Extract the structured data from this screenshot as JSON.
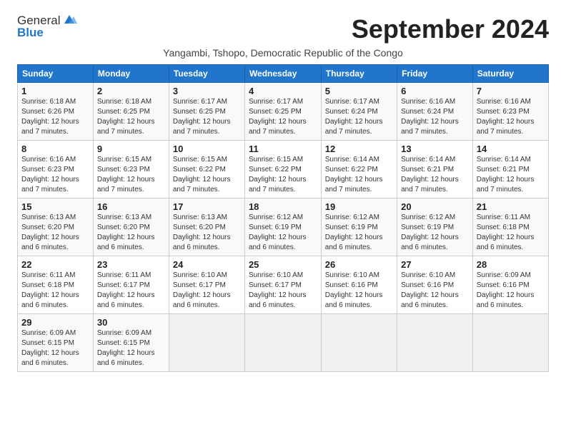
{
  "logo": {
    "general": "General",
    "blue": "Blue"
  },
  "title": "September 2024",
  "subtitle": "Yangambi, Tshopo, Democratic Republic of the Congo",
  "days_of_week": [
    "Sunday",
    "Monday",
    "Tuesday",
    "Wednesday",
    "Thursday",
    "Friday",
    "Saturday"
  ],
  "weeks": [
    [
      {
        "day": "1",
        "info": "Sunrise: 6:18 AM\nSunset: 6:26 PM\nDaylight: 12 hours\nand 7 minutes."
      },
      {
        "day": "2",
        "info": "Sunrise: 6:18 AM\nSunset: 6:25 PM\nDaylight: 12 hours\nand 7 minutes."
      },
      {
        "day": "3",
        "info": "Sunrise: 6:17 AM\nSunset: 6:25 PM\nDaylight: 12 hours\nand 7 minutes."
      },
      {
        "day": "4",
        "info": "Sunrise: 6:17 AM\nSunset: 6:25 PM\nDaylight: 12 hours\nand 7 minutes."
      },
      {
        "day": "5",
        "info": "Sunrise: 6:17 AM\nSunset: 6:24 PM\nDaylight: 12 hours\nand 7 minutes."
      },
      {
        "day": "6",
        "info": "Sunrise: 6:16 AM\nSunset: 6:24 PM\nDaylight: 12 hours\nand 7 minutes."
      },
      {
        "day": "7",
        "info": "Sunrise: 6:16 AM\nSunset: 6:23 PM\nDaylight: 12 hours\nand 7 minutes."
      }
    ],
    [
      {
        "day": "8",
        "info": "Sunrise: 6:16 AM\nSunset: 6:23 PM\nDaylight: 12 hours\nand 7 minutes."
      },
      {
        "day": "9",
        "info": "Sunrise: 6:15 AM\nSunset: 6:23 PM\nDaylight: 12 hours\nand 7 minutes."
      },
      {
        "day": "10",
        "info": "Sunrise: 6:15 AM\nSunset: 6:22 PM\nDaylight: 12 hours\nand 7 minutes."
      },
      {
        "day": "11",
        "info": "Sunrise: 6:15 AM\nSunset: 6:22 PM\nDaylight: 12 hours\nand 7 minutes."
      },
      {
        "day": "12",
        "info": "Sunrise: 6:14 AM\nSunset: 6:22 PM\nDaylight: 12 hours\nand 7 minutes."
      },
      {
        "day": "13",
        "info": "Sunrise: 6:14 AM\nSunset: 6:21 PM\nDaylight: 12 hours\nand 7 minutes."
      },
      {
        "day": "14",
        "info": "Sunrise: 6:14 AM\nSunset: 6:21 PM\nDaylight: 12 hours\nand 7 minutes."
      }
    ],
    [
      {
        "day": "15",
        "info": "Sunrise: 6:13 AM\nSunset: 6:20 PM\nDaylight: 12 hours\nand 6 minutes."
      },
      {
        "day": "16",
        "info": "Sunrise: 6:13 AM\nSunset: 6:20 PM\nDaylight: 12 hours\nand 6 minutes."
      },
      {
        "day": "17",
        "info": "Sunrise: 6:13 AM\nSunset: 6:20 PM\nDaylight: 12 hours\nand 6 minutes."
      },
      {
        "day": "18",
        "info": "Sunrise: 6:12 AM\nSunset: 6:19 PM\nDaylight: 12 hours\nand 6 minutes."
      },
      {
        "day": "19",
        "info": "Sunrise: 6:12 AM\nSunset: 6:19 PM\nDaylight: 12 hours\nand 6 minutes."
      },
      {
        "day": "20",
        "info": "Sunrise: 6:12 AM\nSunset: 6:19 PM\nDaylight: 12 hours\nand 6 minutes."
      },
      {
        "day": "21",
        "info": "Sunrise: 6:11 AM\nSunset: 6:18 PM\nDaylight: 12 hours\nand 6 minutes."
      }
    ],
    [
      {
        "day": "22",
        "info": "Sunrise: 6:11 AM\nSunset: 6:18 PM\nDaylight: 12 hours\nand 6 minutes."
      },
      {
        "day": "23",
        "info": "Sunrise: 6:11 AM\nSunset: 6:17 PM\nDaylight: 12 hours\nand 6 minutes."
      },
      {
        "day": "24",
        "info": "Sunrise: 6:10 AM\nSunset: 6:17 PM\nDaylight: 12 hours\nand 6 minutes."
      },
      {
        "day": "25",
        "info": "Sunrise: 6:10 AM\nSunset: 6:17 PM\nDaylight: 12 hours\nand 6 minutes."
      },
      {
        "day": "26",
        "info": "Sunrise: 6:10 AM\nSunset: 6:16 PM\nDaylight: 12 hours\nand 6 minutes."
      },
      {
        "day": "27",
        "info": "Sunrise: 6:10 AM\nSunset: 6:16 PM\nDaylight: 12 hours\nand 6 minutes."
      },
      {
        "day": "28",
        "info": "Sunrise: 6:09 AM\nSunset: 6:16 PM\nDaylight: 12 hours\nand 6 minutes."
      }
    ],
    [
      {
        "day": "29",
        "info": "Sunrise: 6:09 AM\nSunset: 6:15 PM\nDaylight: 12 hours\nand 6 minutes."
      },
      {
        "day": "30",
        "info": "Sunrise: 6:09 AM\nSunset: 6:15 PM\nDaylight: 12 hours\nand 6 minutes."
      },
      {
        "day": "",
        "info": ""
      },
      {
        "day": "",
        "info": ""
      },
      {
        "day": "",
        "info": ""
      },
      {
        "day": "",
        "info": ""
      },
      {
        "day": "",
        "info": ""
      }
    ]
  ]
}
